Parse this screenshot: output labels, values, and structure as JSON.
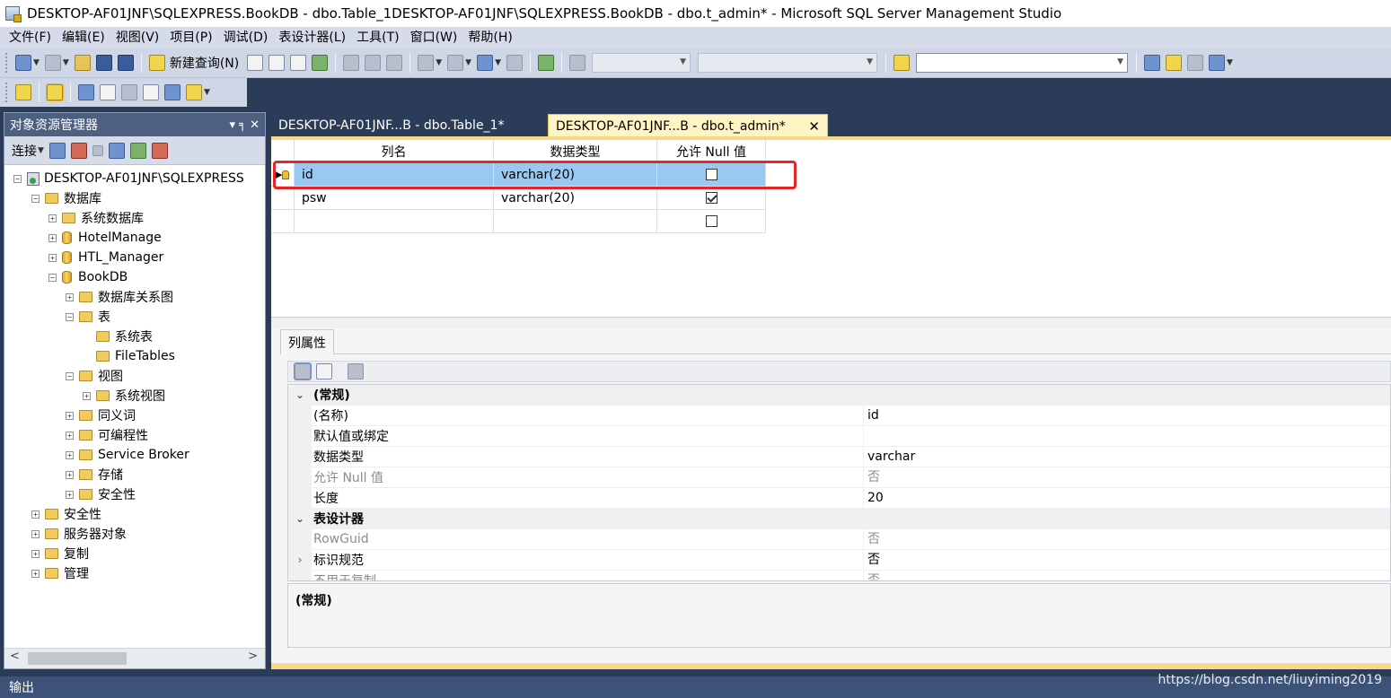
{
  "window": {
    "title": "DESKTOP-AF01JNF\\SQLEXPRESS.BookDB - dbo.Table_1DESKTOP-AF01JNF\\SQLEXPRESS.BookDB - dbo.t_admin* - Microsoft SQL Server Management Studio"
  },
  "menu": [
    "文件(F)",
    "编辑(E)",
    "视图(V)",
    "项目(P)",
    "调试(D)",
    "表设计器(L)",
    "工具(T)",
    "窗口(W)",
    "帮助(H)"
  ],
  "toolbar": {
    "new_query": "新建查询(N)"
  },
  "object_explorer": {
    "title": "对象资源管理器",
    "pin": "▾ ╕ ✕",
    "connect": "连接",
    "tree": {
      "server": "DESKTOP-AF01JNF\\SQLEXPRESS",
      "databases": "数据库",
      "system_db": "系统数据库",
      "hotel": "HotelManage",
      "htl": "HTL_Manager",
      "bookdb": "BookDB",
      "diagrams": "数据库关系图",
      "tables": "表",
      "sys_tables": "系统表",
      "filetables": "FileTables",
      "views": "视图",
      "sys_views": "系统视图",
      "synonyms": "同义词",
      "programmability": "可编程性",
      "service_broker": "Service Broker",
      "storage": "存储",
      "db_security": "安全性",
      "security": "安全性",
      "server_objects": "服务器对象",
      "replication": "复制",
      "management": "管理"
    }
  },
  "tabs": [
    {
      "label": "DESKTOP-AF01JNF...B - dbo.Table_1*"
    },
    {
      "label": "DESKTOP-AF01JNF...B - dbo.t_admin*",
      "close": "✕"
    }
  ],
  "grid": {
    "headers": [
      "列名",
      "数据类型",
      "允许 Null 值"
    ],
    "rows": [
      {
        "name": "id",
        "type": "varchar(20)",
        "nullable": false,
        "key": true
      },
      {
        "name": "psw",
        "type": "varchar(20)",
        "nullable": true
      },
      {
        "name": "",
        "type": "",
        "nullable": false
      }
    ]
  },
  "properties": {
    "tab": "列属性",
    "categories": {
      "general": "(常规)",
      "designer": "表设计器"
    },
    "rows": {
      "name_label": "(名称)",
      "name_value": "id",
      "default_label": "默认值或绑定",
      "default_value": "",
      "type_label": "数据类型",
      "type_value": "varchar",
      "nullable_label": "允许 Null 值",
      "nullable_value": "否",
      "length_label": "长度",
      "length_value": "20",
      "rowguid_label": "RowGuid",
      "rowguid_value": "否",
      "identity_label": "标识规范",
      "identity_value": "否",
      "repl_label": "不用于复制",
      "repl_value": "否"
    },
    "description": "(常规)"
  },
  "output": "输出",
  "watermark": "https://blog.csdn.net/liuyiming2019",
  "colors": {
    "accent_tab": "#fef4c4",
    "highlight": "#e12828",
    "selection": "#99c8f0",
    "chrome": "#2b3c59"
  }
}
